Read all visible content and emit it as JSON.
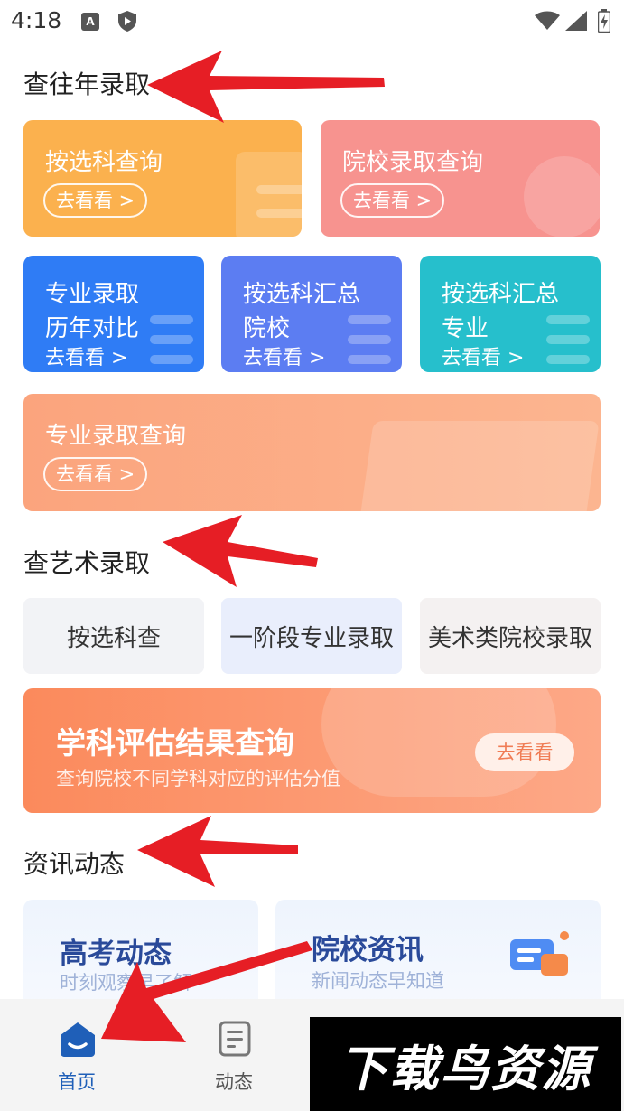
{
  "status_bar": {
    "time": "4:18",
    "a_icon_letter": "A"
  },
  "sections": {
    "past_admission": "查往年录取",
    "art_admission": "查艺术录取",
    "news": "资讯动态"
  },
  "cards": {
    "by_subject": {
      "title": "按选科查询",
      "action": "去看看 >"
    },
    "college_admission": {
      "title": "院校录取查询",
      "action": "去看看 >"
    },
    "major_history": {
      "title_line1": "专业录取",
      "title_line2": "历年对比",
      "action": "去看看 >"
    },
    "subject_college": {
      "title_line1": "按选科汇总",
      "title_line2": "院校",
      "action": "去看看 >"
    },
    "subject_major": {
      "title_line1": "按选科汇总",
      "title_line2": "专业",
      "action": "去看看 >"
    },
    "major_admission": {
      "title": "专业录取查询",
      "action": "去看看 >"
    }
  },
  "art_buttons": [
    "按选科查",
    "一阶段专业录取",
    "美术类院校录取"
  ],
  "evaluation_banner": {
    "title": "学科评估结果查询",
    "subtitle": "查询院校不同学科对应的评估分值",
    "action": "去看看"
  },
  "news_cards": [
    {
      "title": "高考动态",
      "subtitle": "时刻观察早了解"
    },
    {
      "title": "院校资讯",
      "subtitle": "新闻动态早知道"
    }
  ],
  "tabs": [
    {
      "label": "首页",
      "icon": "home-icon",
      "active": true
    },
    {
      "label": "动态",
      "icon": "document-icon",
      "active": false
    }
  ],
  "watermark": "下载鸟资源",
  "colors": {
    "orange": "#fbb14e",
    "pink": "#f7938f",
    "blue": "#2f7cf5",
    "indigo": "#5c7df2",
    "teal": "#26bfcc",
    "peach": "#fb9f7d",
    "active_tab": "#1f5fb8",
    "arrow_red": "#e61e25"
  }
}
